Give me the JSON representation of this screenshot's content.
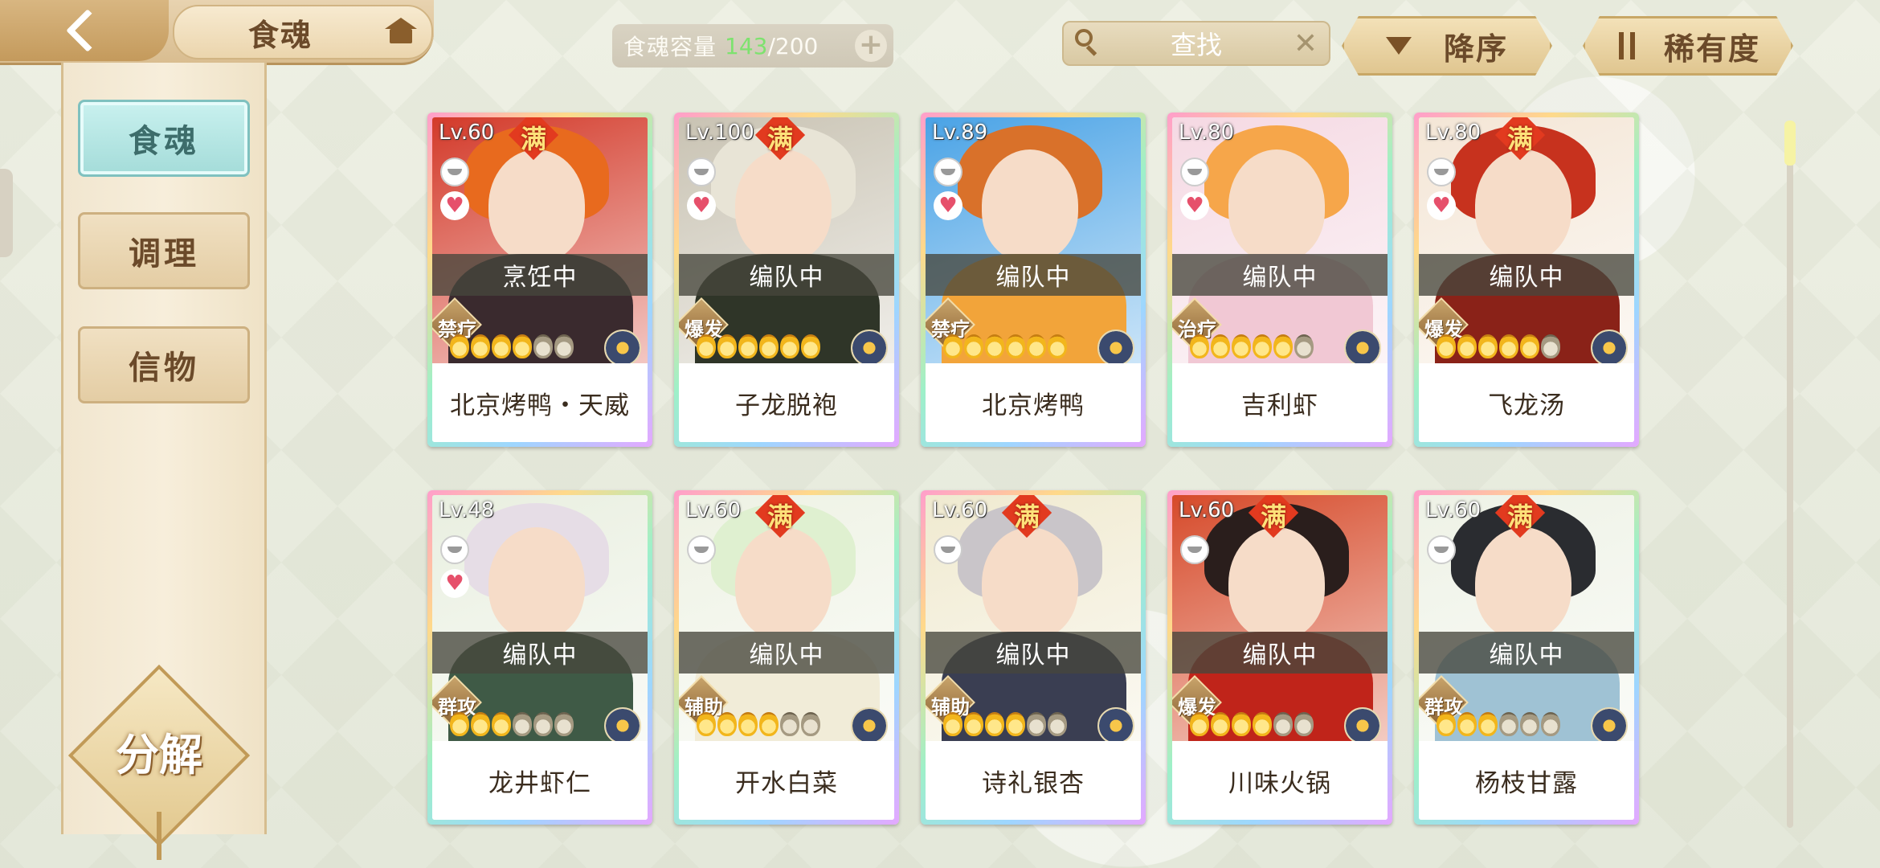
{
  "header": {
    "title": "食魂",
    "capacity_label": "食魂容量",
    "capacity_current": "143",
    "capacity_max": "/200",
    "capacity_add": "+",
    "search_placeholder": "查找",
    "search_clear": "✕",
    "sort_order_label": "降序",
    "sort_key_label": "稀有度"
  },
  "sidebar": {
    "tabs": [
      {
        "label": "食魂",
        "active": true
      },
      {
        "label": "调理",
        "active": false
      },
      {
        "label": "信物",
        "active": false
      }
    ],
    "decompose_label": "分解"
  },
  "status_labels": {
    "cooking": "烹饪中",
    "team": "编队中"
  },
  "max_badge": "满",
  "cards": [
    {
      "name": "北京烤鸭・天威",
      "level": "Lv.60",
      "max": true,
      "status": "烹饪中",
      "role": "禁疗",
      "stars": 4,
      "heart": true,
      "hair": "#e86a1e",
      "body": "#3a2a2e",
      "bg": "#d33a2a"
    },
    {
      "name": "子龙脱袍",
      "level": "Lv.100",
      "max": true,
      "status": "编队中",
      "role": "爆发",
      "stars": 6,
      "heart": true,
      "hair": "#e8e4d6",
      "body": "#2f3528",
      "bg": "#c9c3b3"
    },
    {
      "name": "北京烤鸭",
      "level": "Lv.89",
      "max": false,
      "status": "编队中",
      "role": "禁疗",
      "stars": 6,
      "heart": true,
      "hair": "#d9712a",
      "body": "#f2a43a",
      "bg": "#4aa3e6"
    },
    {
      "name": "吉利虾",
      "level": "Lv.80",
      "max": false,
      "status": "编队中",
      "role": "治疗",
      "stars": 5,
      "heart": true,
      "hair": "#f6a64a",
      "body": "#f1c8d4",
      "bg": "#f5d9e3"
    },
    {
      "name": "飞龙汤",
      "level": "Lv.80",
      "max": true,
      "status": "编队中",
      "role": "爆发",
      "stars": 5,
      "heart": true,
      "hair": "#c7321e",
      "body": "#8a2218",
      "bg": "#f4e6d6"
    },
    {
      "name": "龙井虾仁",
      "level": "Lv.48",
      "max": false,
      "status": "编队中",
      "role": "群攻",
      "stars": 3,
      "heart": true,
      "hair": "#e6dde6",
      "body": "#3f5a46",
      "bg": "#e9efe0"
    },
    {
      "name": "开水白菜",
      "level": "Lv.60",
      "max": true,
      "status": "编队中",
      "role": "辅助",
      "stars": 4,
      "heart": false,
      "hair": "#dff0d0",
      "body": "#f1ecd8",
      "bg": "#eef2e4"
    },
    {
      "name": "诗礼银杏",
      "level": "Lv.60",
      "max": true,
      "status": "编队中",
      "role": "辅助",
      "stars": 4,
      "heart": false,
      "hair": "#c9c5c9",
      "body": "#3a3e52",
      "bg": "#f0ead0"
    },
    {
      "name": "川味火锅",
      "level": "Lv.60",
      "max": true,
      "status": "编队中",
      "role": "爆发",
      "stars": 4,
      "heart": false,
      "hair": "#2a1e1c",
      "body": "#c0241a",
      "bg": "#d64a2a"
    },
    {
      "name": "杨枝甘露",
      "level": "Lv.60",
      "max": true,
      "status": "编队中",
      "role": "群攻",
      "stars": 3,
      "heart": false,
      "hair": "#2a2c30",
      "body": "#9fc2d4",
      "bg": "#eef2e6"
    }
  ],
  "colors": {
    "accent_green": "#7ee26f",
    "tab_active": "#a4dcd9",
    "tab_inactive": "#e4cda4",
    "status_bar": "#46463c"
  }
}
